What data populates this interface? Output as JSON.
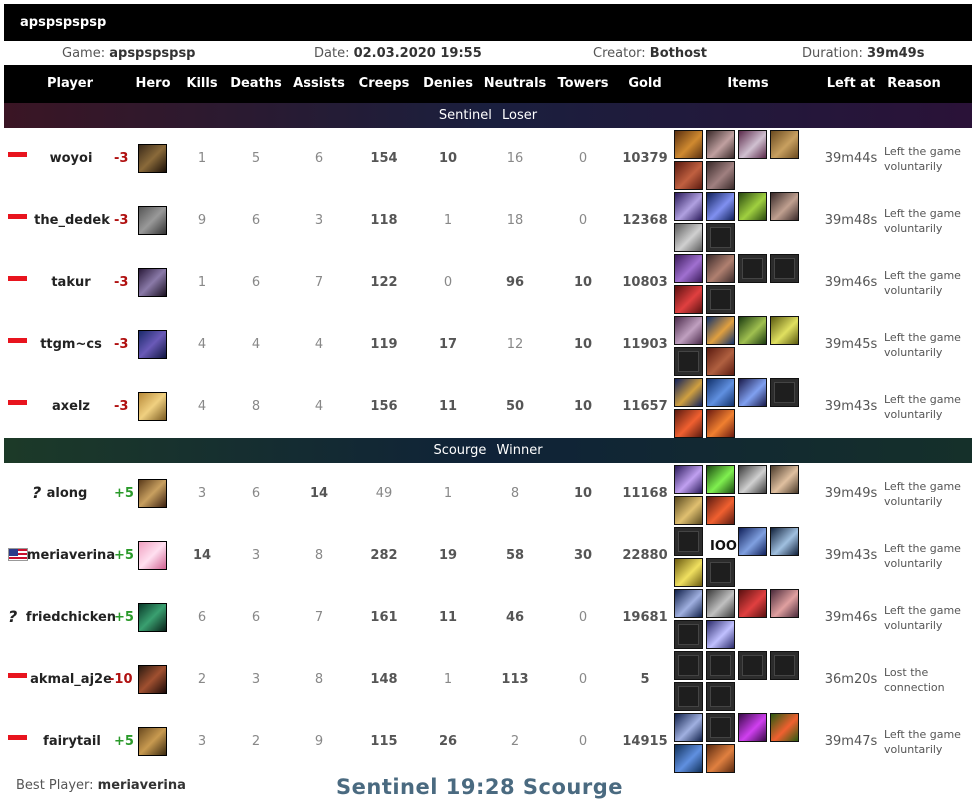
{
  "title": "apspspspsp",
  "info": {
    "game_label": "Game:",
    "game_value": "apspspspsp",
    "date_label": "Date:",
    "date_value": "02.03.2020 19:55",
    "creator_label": "Creator:",
    "creator_value": "Bothost",
    "duration_label": "Duration:",
    "duration_value": "39m49s"
  },
  "columns": [
    "Player",
    "Hero",
    "Kills",
    "Deaths",
    "Assists",
    "Creeps",
    "Denies",
    "Neutrals",
    "Towers",
    "Gold",
    "Items",
    "Left at",
    "Reason"
  ],
  "sentinel_label": "Sentinel  Loser",
  "scourge_label": "Scourge  Winner",
  "colors": {
    "negative": "#b01010",
    "positive": "#2a9a2a",
    "score": "#4a6a80"
  },
  "sentinel": [
    {
      "flag": "red",
      "name": "woyoi",
      "change": "-3",
      "kills": "1",
      "deaths": "5",
      "assists": "6",
      "creeps": "154",
      "denies": "10",
      "neutrals": "16",
      "towers": "0",
      "gold": "10379",
      "left_at": "39m44s",
      "reason_1": "Left the game",
      "reason_2": "voluntarily"
    },
    {
      "flag": "red",
      "name": "the_dedek",
      "change": "-3",
      "kills": "9",
      "deaths": "6",
      "assists": "3",
      "creeps": "118",
      "denies": "1",
      "neutrals": "18",
      "towers": "0",
      "gold": "12368",
      "left_at": "39m48s",
      "reason_1": "Left the game",
      "reason_2": "voluntarily"
    },
    {
      "flag": "red",
      "name": "takur",
      "change": "-3",
      "kills": "1",
      "deaths": "6",
      "assists": "7",
      "creeps": "122",
      "denies": "0",
      "neutrals": "96",
      "towers": "10",
      "gold": "10803",
      "left_at": "39m46s",
      "reason_1": "Left the game",
      "reason_2": "voluntarily"
    },
    {
      "flag": "red",
      "name": "ttgm~cs",
      "change": "-3",
      "kills": "4",
      "deaths": "4",
      "assists": "4",
      "creeps": "119",
      "denies": "17",
      "neutrals": "12",
      "towers": "10",
      "gold": "11903",
      "left_at": "39m45s",
      "reason_1": "Left the game",
      "reason_2": "voluntarily"
    },
    {
      "flag": "red",
      "name": "axelz",
      "change": "-3",
      "kills": "4",
      "deaths": "8",
      "assists": "4",
      "creeps": "156",
      "denies": "11",
      "neutrals": "50",
      "towers": "10",
      "gold": "11657",
      "left_at": "39m43s",
      "reason_1": "Left the game",
      "reason_2": "voluntarily"
    }
  ],
  "scourge": [
    {
      "flag": "unknown",
      "flag_text": "?",
      "name": "along",
      "change": "+5",
      "kills": "3",
      "deaths": "6",
      "assists": "14",
      "creeps": "49",
      "denies": "1",
      "neutrals": "8",
      "towers": "10",
      "gold": "11168",
      "left_at": "39m49s",
      "reason_1": "Left the game",
      "reason_2": "voluntarily"
    },
    {
      "flag": "us",
      "name": "meriaverina",
      "change": "+5",
      "kills": "14",
      "deaths": "3",
      "assists": "8",
      "creeps": "282",
      "denies": "19",
      "neutrals": "58",
      "towers": "30",
      "gold": "22880",
      "left_at": "39m43s",
      "reason_1": "Left the game",
      "reason_2": "voluntarily",
      "item_text": "IOOL"
    },
    {
      "flag": "unknown",
      "flag_text": "?",
      "name": "friedchicken",
      "change": "+5",
      "kills": "6",
      "deaths": "6",
      "assists": "7",
      "creeps": "161",
      "denies": "11",
      "neutrals": "46",
      "towers": "0",
      "gold": "19681",
      "left_at": "39m46s",
      "reason_1": "Left the game",
      "reason_2": "voluntarily"
    },
    {
      "flag": "red",
      "name": "akmal_aj2e",
      "change": "-10",
      "kills": "2",
      "deaths": "3",
      "assists": "8",
      "creeps": "148",
      "denies": "1",
      "neutrals": "113",
      "towers": "0",
      "gold": "5",
      "left_at": "36m20s",
      "reason_1": "Lost the",
      "reason_2": "connection"
    },
    {
      "flag": "red",
      "name": "fairytail",
      "change": "+5",
      "kills": "3",
      "deaths": "2",
      "assists": "9",
      "creeps": "115",
      "denies": "26",
      "neutrals": "2",
      "towers": "0",
      "gold": "14915",
      "left_at": "39m47s",
      "reason_1": "Left the game",
      "reason_2": "voluntarily"
    }
  ],
  "footer": {
    "best_label": "Best Player:",
    "best_value": "meriaverina",
    "score": "Sentinel 19:28 Scourge"
  }
}
